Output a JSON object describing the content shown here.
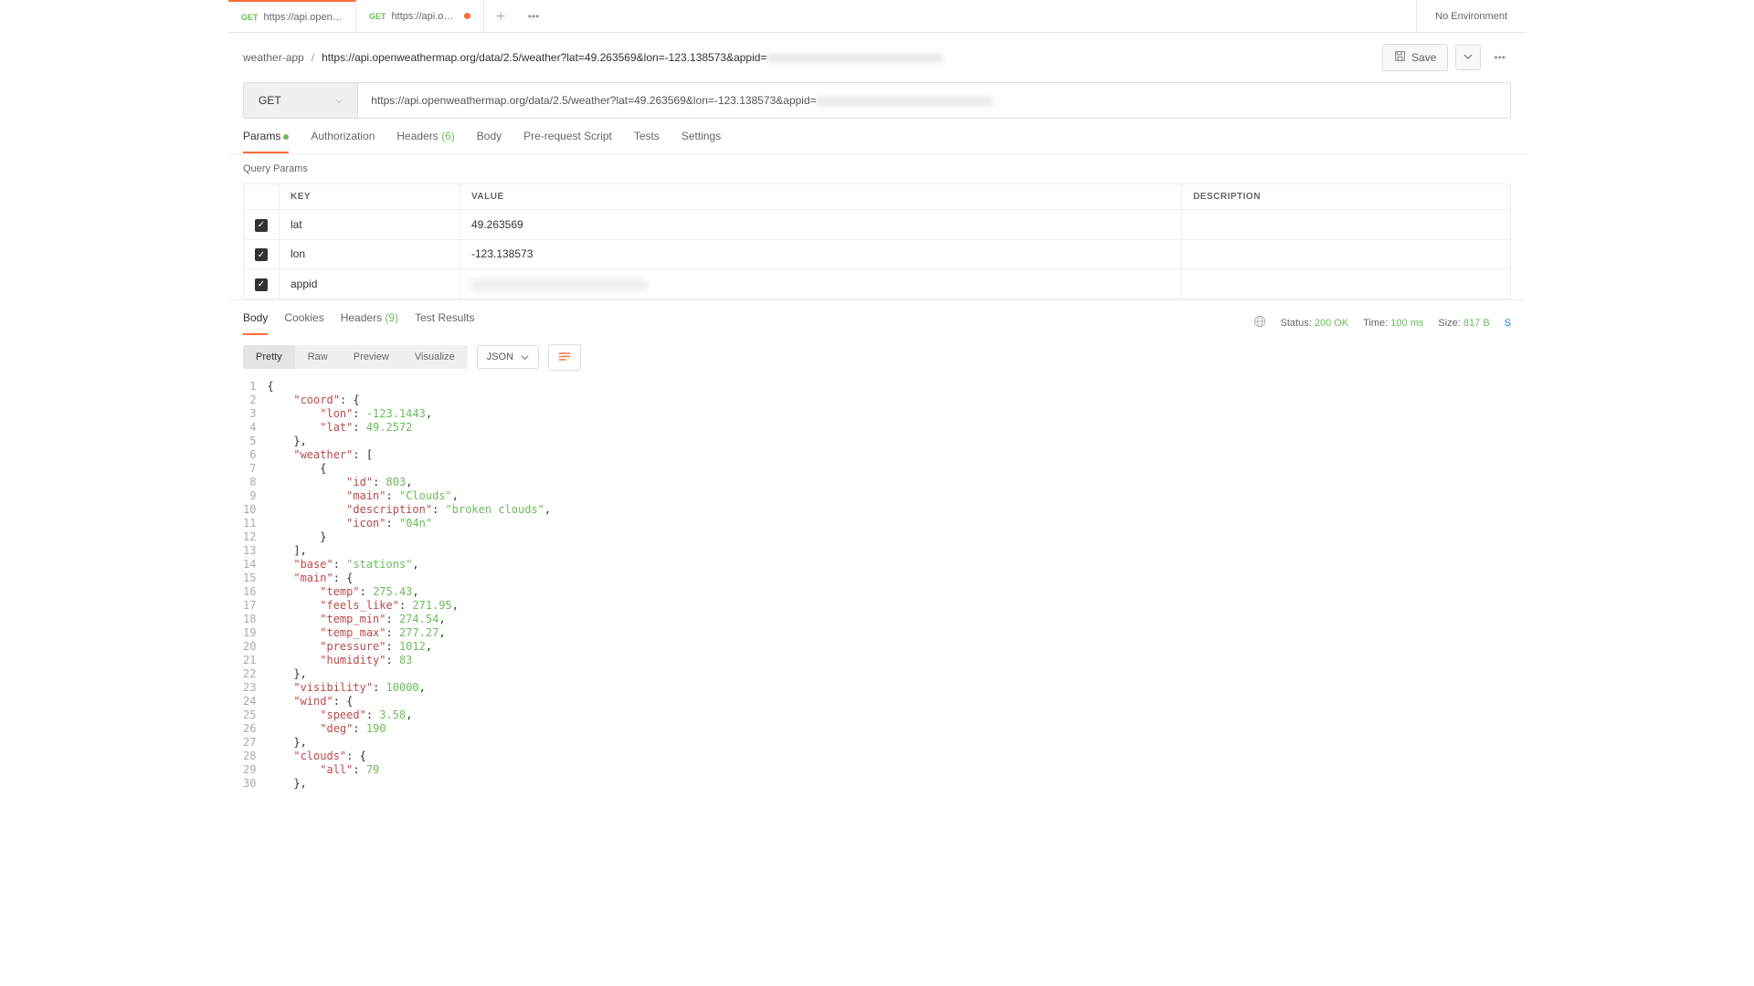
{
  "tabs": [
    {
      "method": "GET",
      "title": "https://api.openweatherm"
    },
    {
      "method": "GET",
      "title": "https://api.openweathe",
      "dirty": true
    }
  ],
  "environment": "No Environment",
  "breadcrumb": {
    "collection": "weather-app",
    "request": "https://api.openweathermap.org/data/2.5/weather?lat=49.263569&lon=-123.138573&appid=",
    "masked": "xxxxxxxxxxxxxxxxxxxxxxxxxxxxxxxx"
  },
  "save_label": "Save",
  "method": "GET",
  "url": "https://api.openweathermap.org/data/2.5/weather?lat=49.263569&lon=-123.138573&appid=",
  "url_masked": "xxxxxxxxxxxxxxxxxxxxxxxxxxxxxxxx",
  "req_tabs": {
    "params": "Params",
    "auth": "Authorization",
    "headers": "Headers",
    "headers_count": "(6)",
    "body": "Body",
    "prereq": "Pre-request Script",
    "tests": "Tests",
    "settings": "Settings"
  },
  "query_params_label": "Query Params",
  "table_headers": {
    "key": "KEY",
    "value": "VALUE",
    "description": "DESCRIPTION"
  },
  "params": [
    {
      "key": "lat",
      "value": "49.263569"
    },
    {
      "key": "lon",
      "value": "-123.138573"
    },
    {
      "key": "appid",
      "value": "xxxxxxxxxxxxxxxxxxxxxxxxxxxxxxxx",
      "masked": true
    }
  ],
  "resp_tabs": {
    "body": "Body",
    "cookies": "Cookies",
    "headers": "Headers",
    "headers_count": "(9)",
    "tests": "Test Results"
  },
  "status": {
    "label": "Status:",
    "code": "200 OK"
  },
  "time": {
    "label": "Time:",
    "val": "100 ms"
  },
  "size": {
    "label": "Size:",
    "val": "817 B"
  },
  "view_tabs": {
    "pretty": "Pretty",
    "raw": "Raw",
    "preview": "Preview",
    "visualize": "Visualize"
  },
  "format": "JSON",
  "response_json": {
    "coord": {
      "lon": -123.1443,
      "lat": 49.2572
    },
    "weather": [
      {
        "id": 803,
        "main": "Clouds",
        "description": "broken clouds",
        "icon": "04n"
      }
    ],
    "base": "stations",
    "main": {
      "temp": 275.43,
      "feels_like": 271.95,
      "temp_min": 274.54,
      "temp_max": 277.27,
      "pressure": 1012,
      "humidity": 83
    },
    "visibility": 10000,
    "wind": {
      "speed": 3.58,
      "deg": 190
    },
    "clouds": {
      "all": 79
    }
  },
  "code_lines": [
    "{",
    "    \"coord\": {",
    "        \"lon\": -123.1443,",
    "        \"lat\": 49.2572",
    "    },",
    "    \"weather\": [",
    "        {",
    "            \"id\": 803,",
    "            \"main\": \"Clouds\",",
    "            \"description\": \"broken clouds\",",
    "            \"icon\": \"04n\"",
    "        }",
    "    ],",
    "    \"base\": \"stations\",",
    "    \"main\": {",
    "        \"temp\": 275.43,",
    "        \"feels_like\": 271.95,",
    "        \"temp_min\": 274.54,",
    "        \"temp_max\": 277.27,",
    "        \"pressure\": 1012,",
    "        \"humidity\": 83",
    "    },",
    "    \"visibility\": 10000,",
    "    \"wind\": {",
    "        \"speed\": 3.58,",
    "        \"deg\": 190",
    "    },",
    "    \"clouds\": {",
    "        \"all\": 79",
    "    },"
  ]
}
